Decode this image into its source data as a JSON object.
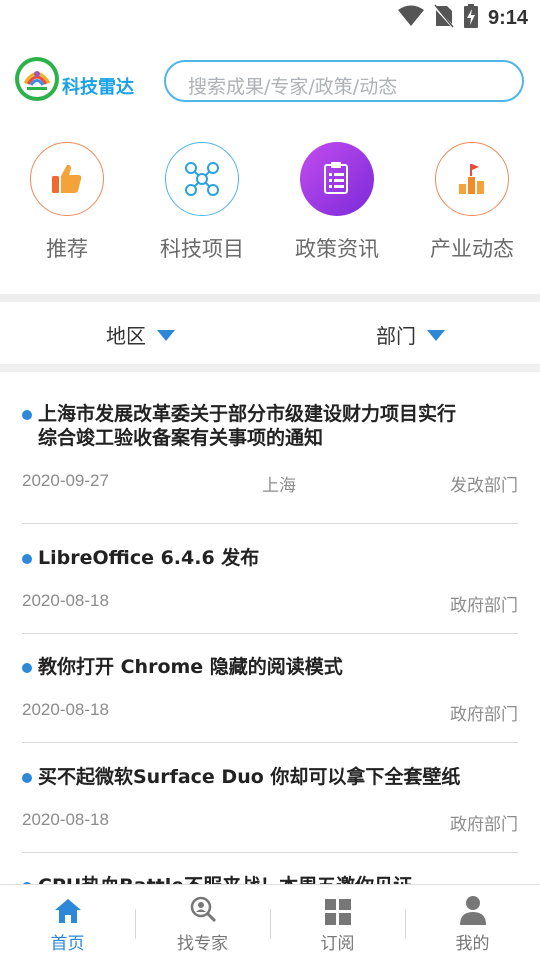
{
  "status": {
    "time": "9:14"
  },
  "header": {
    "app_name": "科技雷达",
    "search_placeholder": "搜索成果/专家/政策/动态"
  },
  "categories": [
    {
      "label": "推荐",
      "icon": "thumbs-up-icon",
      "color": "#f06a30"
    },
    {
      "label": "科技项目",
      "icon": "network-nodes-icon",
      "color": "#2aa3e0"
    },
    {
      "label": "政策资讯",
      "icon": "document-list-icon",
      "color": "#9b3fe0"
    },
    {
      "label": "产业动态",
      "icon": "bar-chart-flag-icon",
      "color": "#f08a2a"
    }
  ],
  "filters": {
    "region": "地区",
    "department": "部门"
  },
  "news": [
    {
      "title_line1": "上海市发展改革委关于部分市级建设财力项目实行",
      "title_line2": "综合竣工验收备案有关事项的通知",
      "date": "2020-09-27",
      "region": "上海",
      "dept": "发改部门"
    },
    {
      "title": "LibreOffice 6.4.6 发布",
      "date": "2020-08-18",
      "dept": "政府部门"
    },
    {
      "title": "教你打开 Chrome 隐藏的阅读模式",
      "date": "2020-08-18",
      "dept": "政府部门"
    },
    {
      "title": "买不起微软Surface Duo 你却可以拿下全套壁纸",
      "date": "2020-08-18",
      "dept": "政府部门"
    },
    {
      "title": "CPU热血Battle不服来战！本周五邀你见证"
    }
  ],
  "bottom_nav": [
    {
      "label": "首页",
      "icon": "home-icon",
      "active": true
    },
    {
      "label": "找专家",
      "icon": "search-expert-icon"
    },
    {
      "label": "订阅",
      "icon": "grid-icon"
    },
    {
      "label": "我的",
      "icon": "person-icon"
    }
  ],
  "colors": {
    "accent": "#2d88d8",
    "search_border": "#4fb5e8"
  }
}
